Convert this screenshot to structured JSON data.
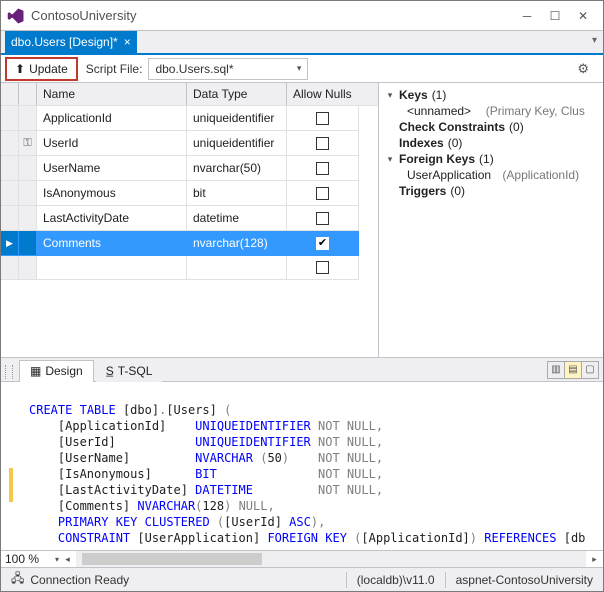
{
  "window": {
    "title": "ContosoUniversity"
  },
  "doc_tab": {
    "label": "dbo.Users [Design]*"
  },
  "toolbar": {
    "update_label": "Update",
    "scriptfile_label": "Script File:",
    "scriptfile_value": "dbo.Users.sql*"
  },
  "grid": {
    "headers": {
      "name": "Name",
      "data_type": "Data Type",
      "allow_nulls": "Allow Nulls"
    },
    "rows": [
      {
        "key": "",
        "name": "ApplicationId",
        "data_type": "uniqueidentifier",
        "allow_nulls": false,
        "selected": false
      },
      {
        "key": "pk",
        "name": "UserId",
        "data_type": "uniqueidentifier",
        "allow_nulls": false,
        "selected": false
      },
      {
        "key": "",
        "name": "UserName",
        "data_type": "nvarchar(50)",
        "allow_nulls": false,
        "selected": false
      },
      {
        "key": "",
        "name": "IsAnonymous",
        "data_type": "bit",
        "allow_nulls": false,
        "selected": false
      },
      {
        "key": "",
        "name": "LastActivityDate",
        "data_type": "datetime",
        "allow_nulls": false,
        "selected": false
      },
      {
        "key": "",
        "name": "Comments",
        "data_type": "nvarchar(128)",
        "allow_nulls": true,
        "selected": true
      }
    ]
  },
  "context": {
    "keys": {
      "label": "Keys",
      "count": "(1)",
      "items": [
        {
          "name": "<unnamed>",
          "detail": "(Primary Key, Clus"
        }
      ]
    },
    "check_constraints": {
      "label": "Check Constraints",
      "count": "(0)"
    },
    "indexes": {
      "label": "Indexes",
      "count": "(0)"
    },
    "foreign_keys": {
      "label": "Foreign Keys",
      "count": "(1)",
      "items": [
        {
          "name": "UserApplication",
          "detail": "(ApplicationId)"
        }
      ]
    },
    "triggers": {
      "label": "Triggers",
      "count": "(0)"
    }
  },
  "split_tabs": {
    "design": "Design",
    "tsql": "T-SQL"
  },
  "sql": {
    "zoom": "100 %",
    "lines": [
      "CREATE TABLE [dbo].[Users] (",
      "    [ApplicationId]    UNIQUEIDENTIFIER NOT NULL,",
      "    [UserId]           UNIQUEIDENTIFIER NOT NULL,",
      "    [UserName]         NVARCHAR (50)    NOT NULL,",
      "    [IsAnonymous]      BIT              NOT NULL,",
      "    [LastActivityDate] DATETIME         NOT NULL,",
      "    [Comments] NVARCHAR(128) NULL,",
      "    PRIMARY KEY CLUSTERED ([UserId] ASC),",
      "    CONSTRAINT [UserApplication] FOREIGN KEY ([ApplicationId]) REFERENCES [db"
    ]
  },
  "status": {
    "connection": "Connection Ready",
    "server": "(localdb)\\v11.0",
    "database": "aspnet-ContosoUniversity"
  }
}
